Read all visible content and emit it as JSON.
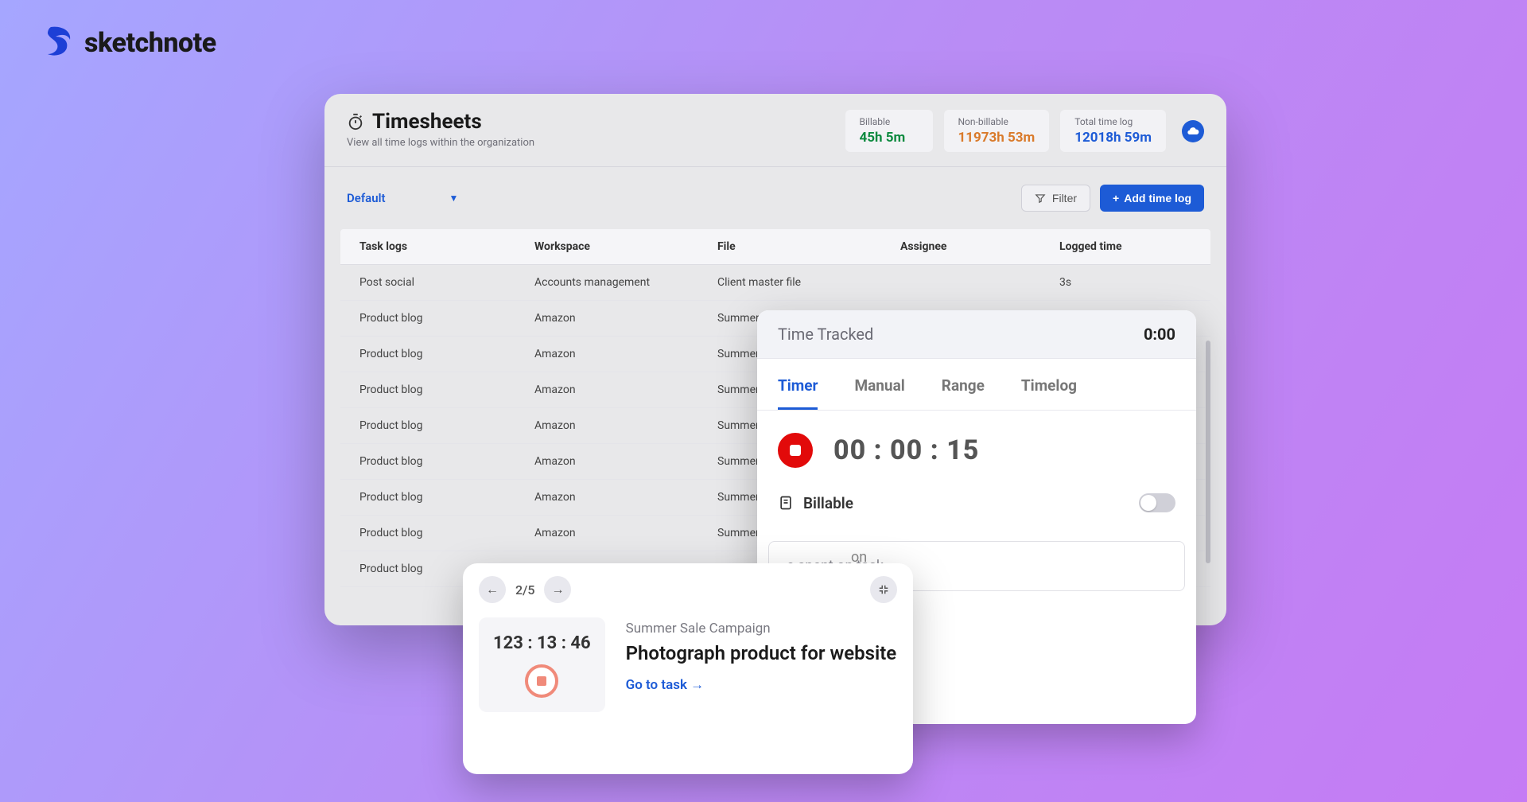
{
  "brand": {
    "name": "sketchnote"
  },
  "header": {
    "title": "Timesheets",
    "subtitle": "View all time logs within the organization"
  },
  "stats": {
    "billable": {
      "label": "Billable",
      "value": "45h 5m"
    },
    "nonbillable": {
      "label": "Non-billable",
      "value": "11973h 53m"
    },
    "total": {
      "label": "Total time log",
      "value": "12018h 59m"
    }
  },
  "toolbar": {
    "view_label": "Default",
    "filter_label": "Filter",
    "add_label": "Add time log"
  },
  "columns": {
    "c0": "Task logs",
    "c1": "Workspace",
    "c2": "File",
    "c3": "Assignee",
    "c4": "Logged time"
  },
  "rows": [
    {
      "task": "Post social",
      "workspace": "Accounts management",
      "file": "Client master file",
      "assignee": "",
      "logged": "3s"
    },
    {
      "task": "Product blog",
      "workspace": "Amazon",
      "file": "Summer",
      "assignee": "",
      "logged": ""
    },
    {
      "task": "Product blog",
      "workspace": "Amazon",
      "file": "Summer",
      "assignee": "",
      "logged": ""
    },
    {
      "task": "Product blog",
      "workspace": "Amazon",
      "file": "Summer",
      "assignee": "",
      "logged": ""
    },
    {
      "task": "Product blog",
      "workspace": "Amazon",
      "file": "Summer",
      "assignee": "",
      "logged": ""
    },
    {
      "task": "Product blog",
      "workspace": "Amazon",
      "file": "Summer",
      "assignee": "",
      "logged": ""
    },
    {
      "task": "Product blog",
      "workspace": "Amazon",
      "file": "Summer",
      "assignee": "",
      "logged": ""
    },
    {
      "task": "Product blog",
      "workspace": "Amazon",
      "file": "Summer",
      "assignee": "",
      "logged": ""
    },
    {
      "task": "Product blog",
      "workspace": "",
      "file": "",
      "assignee": "",
      "logged": ""
    }
  ],
  "tracker": {
    "title": "Time Tracked",
    "elapsed": "0:00",
    "tabs": {
      "timer": "Timer",
      "manual": "Manual",
      "range": "Range",
      "timelog": "Timelog"
    },
    "timer_value": "00 : 00 : 15",
    "billable_label": "Billable",
    "ghost_on": "on",
    "desc_placeholder": "e spent on task"
  },
  "mini": {
    "page": "2/5",
    "timer": "123 : 13 : 46",
    "campaign": "Summer Sale Campaign",
    "task": "Photograph product for website",
    "link": "Go to task →"
  }
}
